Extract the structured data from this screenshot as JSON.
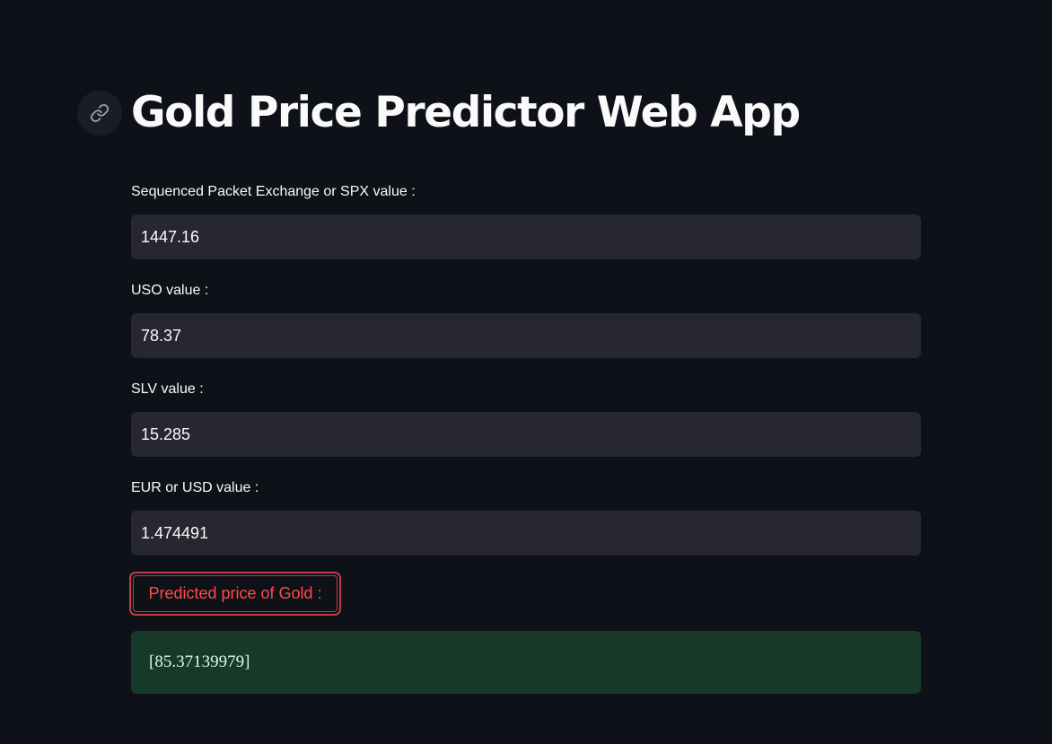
{
  "header": {
    "title": "Gold Price Predictor Web App",
    "anchor_icon": "link-icon"
  },
  "form": {
    "fields": [
      {
        "label": "Sequenced Packet Exchange or SPX value :",
        "value": "1447.16"
      },
      {
        "label": "USO value :",
        "value": "78.37"
      },
      {
        "label": "SLV value :",
        "value": "15.285"
      },
      {
        "label": "EUR or USD value :",
        "value": "1.474491"
      }
    ],
    "predict_button_label": "Predicted price of Gold :"
  },
  "result": {
    "text": "[85.37139979]"
  },
  "colors": {
    "background": "#0e1117",
    "input_background": "#262730",
    "button_accent": "#ff4b4b",
    "success_background": "#173928"
  }
}
